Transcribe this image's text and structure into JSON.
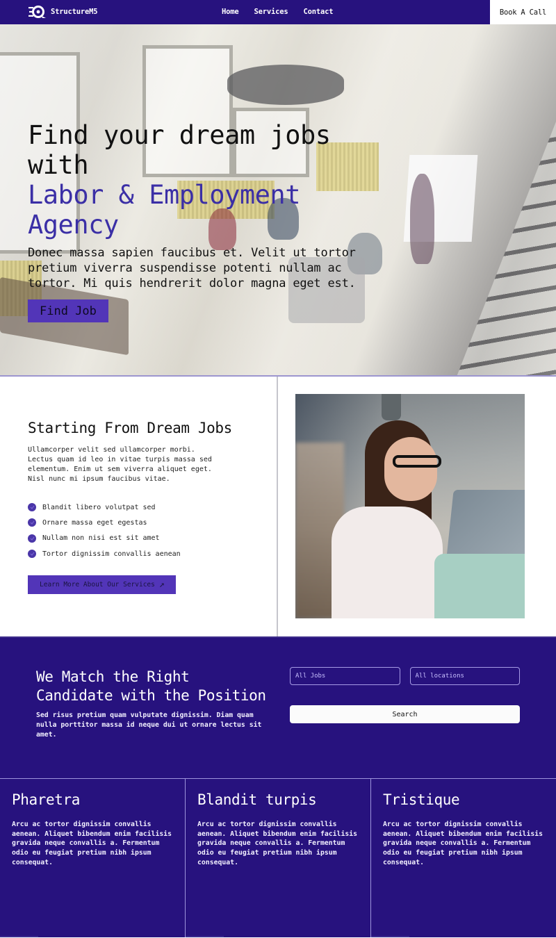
{
  "nav": {
    "brand": "StructureM5",
    "links": [
      "Home",
      "Services",
      "Contact"
    ],
    "cta": "Book A Call"
  },
  "hero": {
    "title_line1": "Find your dream jobs",
    "title_line2": "with",
    "title_accent1": "Labor & Employment",
    "title_accent2": "Agency",
    "text": "Donec massa sapien faucibus et. Velit ut tortor pretium viverra suspendisse potenti nullam ac tortor. Mi quis hendrerit dolor magna eget est.",
    "button": "Find Job"
  },
  "about": {
    "title": "Starting From Dream Jobs",
    "text": "Ullamcorper velit sed ullamcorper morbi. Lectus quam id leo in vitae turpis massa sed elementum. Enim ut sem viverra aliquet eget. Nisl nunc mi ipsum faucibus vitae.",
    "checklist": [
      "Blandit libero volutpat sed",
      "Ornare massa eget egestas",
      "Nullam non nisi est sit amet",
      "Tortor dignissim convallis aenean"
    ],
    "button": "Learn More About Our Services",
    "button_icon": "↗"
  },
  "match": {
    "title": "We Match the Right Candidate with the Position",
    "text": "Sed risus pretium quam vulputate dignissim. Diam quam nulla porttitor massa id neque dui ut ornare lectus sit amet.",
    "jobs_placeholder": "All Jobs",
    "locations_placeholder": "All locations",
    "search_button": "Search"
  },
  "features": [
    {
      "title": "Pharetra",
      "text": "Arcu ac tortor dignissim convallis aenean. Aliquet bibendum enim facilisis gravida neque convallis a. Fermentum odio eu feugiat pretium nibh ipsum consequat."
    },
    {
      "title": "Blandit turpis",
      "text": "Arcu ac tortor dignissim convallis aenean. Aliquet bibendum enim facilisis gravida neque convallis a. Fermentum odio eu feugiat pretium nibh ipsum consequat."
    },
    {
      "title": "Tristique",
      "text": "Arcu ac tortor dignissim convallis aenean. Aliquet bibendum enim facilisis gravida neque convallis a. Fermentum odio eu feugiat pretium nibh ipsum consequat."
    }
  ],
  "colors": {
    "brand": "#27127e",
    "accent": "#5235b8",
    "accent_text": "#3b2fa6"
  }
}
